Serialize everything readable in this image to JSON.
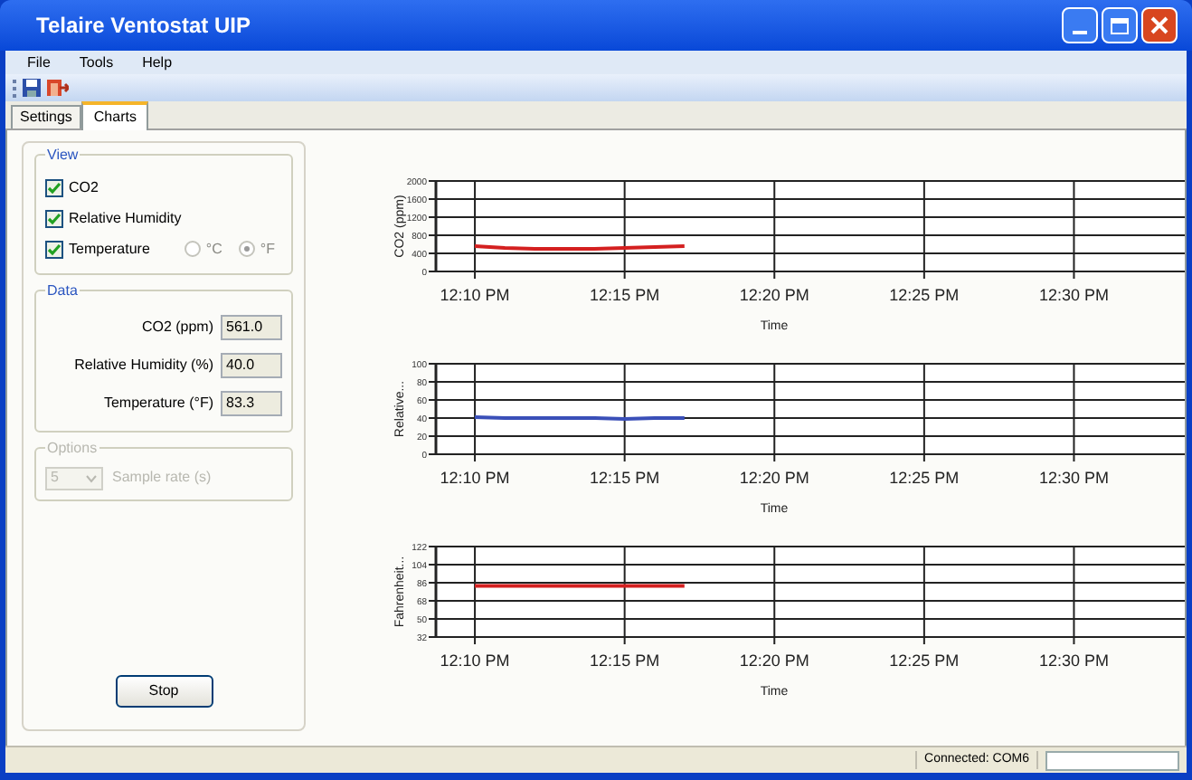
{
  "window": {
    "title": "Telaire Ventostat UIP"
  },
  "menu": [
    "File",
    "Tools",
    "Help"
  ],
  "tabs": [
    {
      "label": "Settings",
      "selected": false
    },
    {
      "label": "Charts",
      "selected": true
    }
  ],
  "view": {
    "title": "View",
    "checkboxes": [
      {
        "label": "CO2",
        "checked": true
      },
      {
        "label": "Relative Humidity",
        "checked": true
      },
      {
        "label": "Temperature",
        "checked": true
      }
    ],
    "units": [
      {
        "label": "°C",
        "selected": false
      },
      {
        "label": "°F",
        "selected": true
      }
    ]
  },
  "data": {
    "title": "Data",
    "fields": [
      {
        "label": "CO2 (ppm)",
        "value": "561.0"
      },
      {
        "label": "Relative Humidity (%)",
        "value": "40.0"
      },
      {
        "label": "Temperature (°F)",
        "value": "83.3"
      }
    ]
  },
  "options": {
    "title": "Options",
    "disabled": true,
    "sample_rate": "5",
    "label": "Sample rate (s)"
  },
  "stop_button": "Stop",
  "charts": [
    {
      "chart_data": {
        "type": "line",
        "grid": true,
        "xlabel": "Time",
        "ylabel": "CO2 (ppm)",
        "ylim": [
          0,
          2000
        ],
        "yticks": [
          0,
          400,
          800,
          1200,
          1600,
          2000
        ],
        "categories": [
          null,
          "12:10 PM",
          null,
          null,
          null,
          null,
          "12:15 PM",
          null,
          null,
          null,
          null,
          "12:20 PM",
          null,
          null,
          null,
          null,
          "12:25 PM",
          null,
          null,
          null,
          null,
          "12:30 PM",
          null,
          null,
          null
        ],
        "series": [
          {
            "color": "#d42020",
            "values": [
              null,
              560,
              520,
              500,
              500,
              500,
              520,
              540,
              560,
              null,
              null,
              null,
              null,
              null,
              null,
              null,
              null,
              null,
              null,
              null,
              null,
              null,
              null,
              null,
              null
            ]
          }
        ]
      }
    },
    {
      "chart_data": {
        "type": "line",
        "grid": true,
        "xlabel": "Time",
        "ylabel": "Relative...",
        "ylim": [
          0,
          100
        ],
        "yticks": [
          0,
          20,
          40,
          60,
          80,
          100
        ],
        "categories": [
          null,
          "12:10 PM",
          null,
          null,
          null,
          null,
          "12:15 PM",
          null,
          null,
          null,
          null,
          "12:20 PM",
          null,
          null,
          null,
          null,
          "12:25 PM",
          null,
          null,
          null,
          null,
          "12:30 PM",
          null,
          null,
          null
        ],
        "series": [
          {
            "color": "#3a4fb8",
            "values": [
              null,
              41,
              40,
              40,
              40,
              40,
              39,
              40,
              40,
              null,
              null,
              null,
              null,
              null,
              null,
              null,
              null,
              null,
              null,
              null,
              null,
              null,
              null,
              null,
              null
            ]
          }
        ]
      }
    },
    {
      "chart_data": {
        "type": "line",
        "grid": true,
        "xlabel": "Time",
        "ylabel": "Fahrenheit...",
        "ylim": [
          32,
          122
        ],
        "yticks": [
          32,
          50,
          68,
          86,
          104,
          122
        ],
        "categories": [
          null,
          "12:10 PM",
          null,
          null,
          null,
          null,
          "12:15 PM",
          null,
          null,
          null,
          null,
          "12:20 PM",
          null,
          null,
          null,
          null,
          "12:25 PM",
          null,
          null,
          null,
          null,
          "12:30 PM",
          null,
          null,
          null
        ],
        "series": [
          {
            "color": "#d42020",
            "values": [
              null,
              83,
              83,
              83,
              83,
              83,
              83,
              83,
              83,
              null,
              null,
              null,
              null,
              null,
              null,
              null,
              null,
              null,
              null,
              null,
              null,
              null,
              null,
              null,
              null
            ]
          }
        ]
      }
    }
  ],
  "status": {
    "text": "Connected: COM6",
    "progress": {
      "level": 0
    }
  }
}
